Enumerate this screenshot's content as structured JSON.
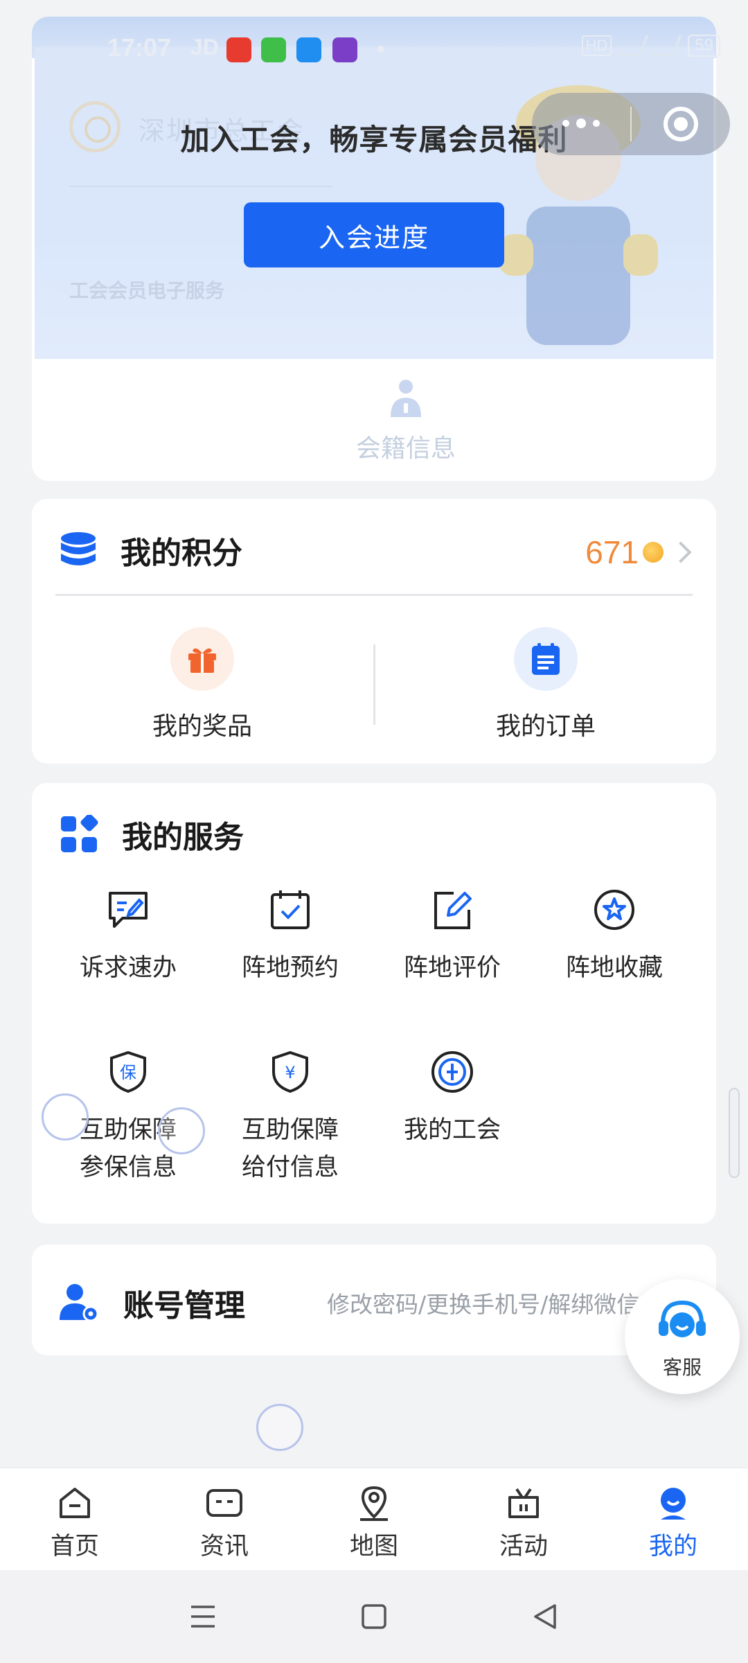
{
  "status_bar": {
    "time": "17:07",
    "carrier_label": "JD",
    "battery": "59",
    "hd_label": "HD",
    "app_icons": [
      {
        "name": "ting-app-icon",
        "color": "#e63b2e"
      },
      {
        "name": "message-app-icon",
        "color": "#3fbf4a"
      },
      {
        "name": "qq-app-icon",
        "color": "#1f8ef0"
      },
      {
        "name": "game-app-icon",
        "color": "#7a3ec7"
      }
    ]
  },
  "capsule": {
    "more_icon": "more-dots-icon",
    "close_icon": "close-target-icon"
  },
  "hero": {
    "union_name": "深圳市总工会",
    "subtitle": "工会会员电子服务",
    "title": "加入工会，畅享专属会员福利",
    "join_button": "入会进度",
    "membership_label": "会籍信息"
  },
  "points": {
    "title": "我的积分",
    "value": "671",
    "items": [
      {
        "label": "我的奖品",
        "icon": "gift-icon"
      },
      {
        "label": "我的订单",
        "icon": "order-icon"
      }
    ]
  },
  "services": {
    "title": "我的服务",
    "items": [
      {
        "label": "诉求速办",
        "icon": "chat-edit-icon"
      },
      {
        "label": "阵地预约",
        "icon": "calendar-check-icon"
      },
      {
        "label": "阵地评价",
        "icon": "edit-square-icon"
      },
      {
        "label": "阵地收藏",
        "icon": "star-circle-icon"
      },
      {
        "label": "互助保障参保信息",
        "line1": "互助保障",
        "line2": "参保信息",
        "icon": "shield-bao-icon"
      },
      {
        "label": "互助保障给付信息",
        "line1": "互助保障",
        "line2": "给付信息",
        "icon": "shield-yen-icon"
      },
      {
        "label": "我的工会",
        "icon": "union-logo-icon"
      }
    ]
  },
  "account": {
    "title": "账号管理",
    "description": "修改密码/更换手机号/解绑微信号"
  },
  "customer_service": {
    "label": "客服"
  },
  "tabbar": {
    "active_color": "#1a66f2",
    "tabs": [
      {
        "label": "首页",
        "icon": "home-icon",
        "active": false
      },
      {
        "label": "资讯",
        "icon": "news-icon",
        "active": false
      },
      {
        "label": "地图",
        "icon": "map-pin-icon",
        "active": false
      },
      {
        "label": "活动",
        "icon": "activity-icon",
        "active": false
      },
      {
        "label": "我的",
        "icon": "profile-icon",
        "active": true
      }
    ]
  },
  "system_nav": {
    "menu_icon": "menu-icon",
    "home_icon": "square-home-icon",
    "back_icon": "back-triangle-icon"
  }
}
